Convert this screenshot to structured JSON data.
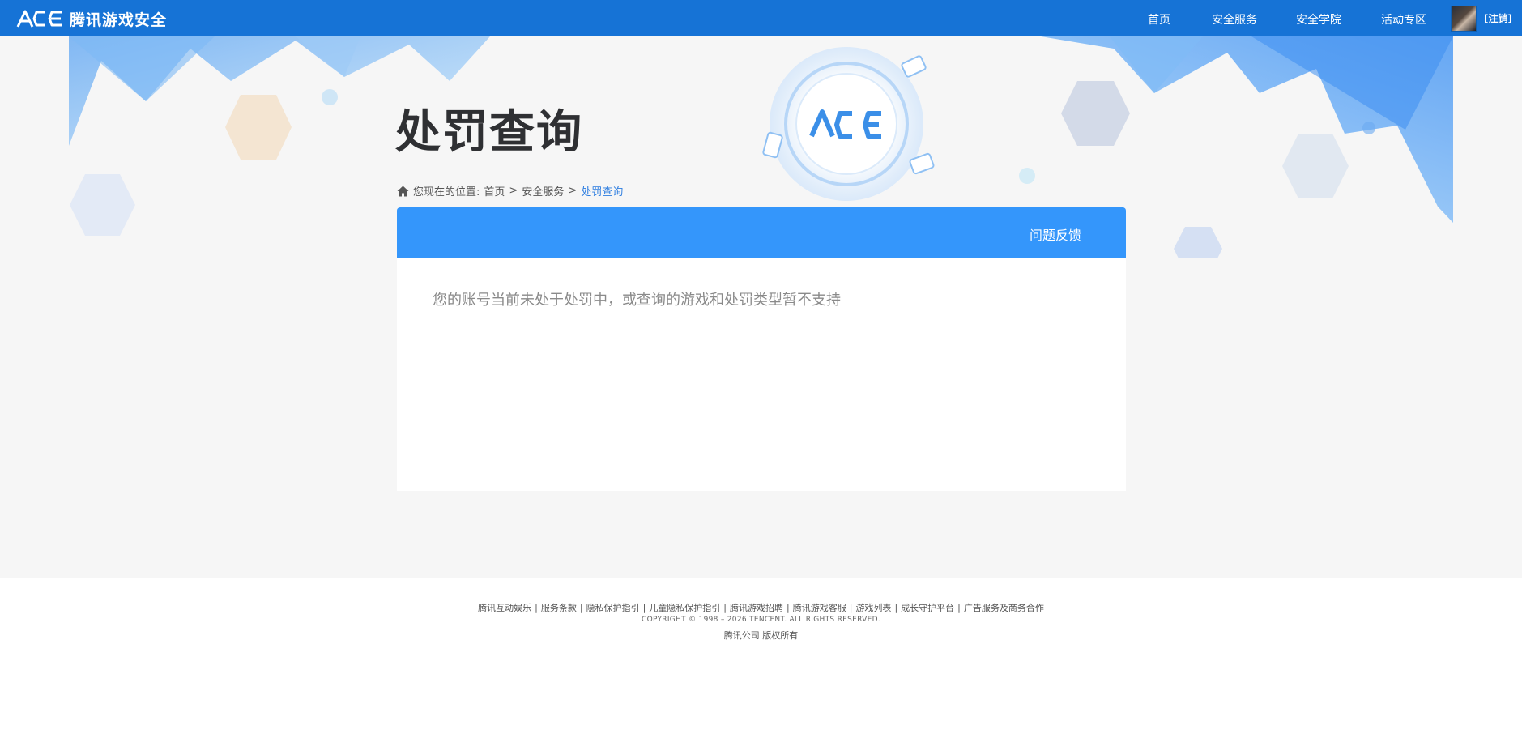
{
  "header": {
    "brand": "腾讯游戏安全",
    "logo_icon": "ace-logo",
    "nav": [
      {
        "label": "首页"
      },
      {
        "label": "安全服务"
      },
      {
        "label": "安全学院"
      },
      {
        "label": "活动专区"
      }
    ],
    "logout_label": "[注销]"
  },
  "page": {
    "title": "处罚查询",
    "breadcrumb": {
      "prefix": "您现在的位置:",
      "items": [
        "首页",
        "安全服务"
      ],
      "current": "处罚查询",
      "separator": ">"
    }
  },
  "panel": {
    "feedback_label": "问题反馈",
    "message": "您的账号当前未处于处罚中，或查询的游戏和处罚类型暂不支持"
  },
  "footer": {
    "links": [
      "腾讯互动娱乐",
      "服务条款",
      "隐私保护指引",
      "儿童隐私保护指引",
      "腾讯游戏招聘",
      "腾讯游戏客服",
      "游戏列表",
      "成长守护平台",
      "广告服务及商务合作"
    ],
    "separator": "|",
    "copyright": "COPYRIGHT © 1998 – 2026 TENCENT. ALL RIGHTS RESERVED.",
    "company": "腾讯公司 版权所有"
  },
  "colors": {
    "topbar": "#1673d6",
    "panel_header": "#3496fb",
    "page_bg": "#f6f6f6",
    "breadcrumb_current": "#2d7de0"
  }
}
